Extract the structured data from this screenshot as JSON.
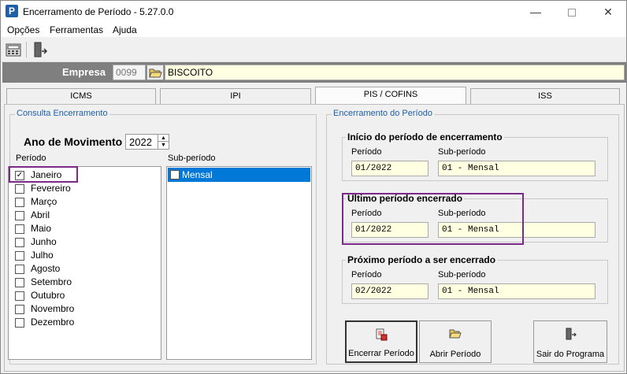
{
  "window": {
    "title": "Encerramento de Período - 5.27.0.0",
    "icon_letter": "P",
    "controls": [
      "minimize-icon",
      "maximize-icon",
      "close-icon"
    ]
  },
  "menu": [
    "Opções",
    "Ferramentas",
    "Ajuda"
  ],
  "toolbar": {
    "icons": [
      "calculator-icon",
      "exit-door-icon"
    ]
  },
  "empresa": {
    "label": "Empresa",
    "code_value": "0099",
    "name_value": "BISCOITO"
  },
  "tabs": [
    {
      "label": "ICMS",
      "active": false
    },
    {
      "label": "IPI",
      "active": false
    },
    {
      "label": "PIS / COFINS",
      "active": true
    },
    {
      "label": "ISS",
      "active": false
    }
  ],
  "consulta": {
    "title": "Consulta Encerramento",
    "ano_label": "Ano de Movimento",
    "ano_value": "2022",
    "periodo_label": "Período",
    "subperiodo_label": "Sub-período",
    "periodos": [
      {
        "label": "Janeiro",
        "checked": true
      },
      {
        "label": "Fevereiro",
        "checked": false
      },
      {
        "label": "Março",
        "checked": false
      },
      {
        "label": "Abril",
        "checked": false
      },
      {
        "label": "Maio",
        "checked": false
      },
      {
        "label": "Junho",
        "checked": false
      },
      {
        "label": "Julho",
        "checked": false
      },
      {
        "label": "Agosto",
        "checked": false
      },
      {
        "label": "Setembro",
        "checked": false
      },
      {
        "label": "Outubro",
        "checked": false
      },
      {
        "label": "Novembro",
        "checked": false
      },
      {
        "label": "Dezembro",
        "checked": false
      }
    ],
    "subperiodos": [
      {
        "label": "Mensal",
        "checked": false,
        "selected": true
      }
    ]
  },
  "encerramento": {
    "title": "Encerramento do Período",
    "inicio": {
      "title": "Início do período de encerramento",
      "periodo_label": "Período",
      "subperiodo_label": "Sub-período",
      "periodo_value": "01/2022",
      "subperiodo_value": "01 - Mensal"
    },
    "ultimo": {
      "title": "Ultimo período encerrado",
      "periodo_label": "Período",
      "subperiodo_label": "Sub-período",
      "periodo_value": "01/2022",
      "subperiodo_value": "01 - Mensal"
    },
    "proximo": {
      "title": "Próximo período a ser encerrado",
      "periodo_label": "Período",
      "subperiodo_label": "Sub-período",
      "periodo_value": "02/2022",
      "subperiodo_value": "01 - Mensal"
    }
  },
  "buttons": {
    "encerrar": "Encerrar Período",
    "abrir": "Abrir Período",
    "sair": "Sair do Programa"
  },
  "colors": {
    "highlight": "#7b2a8a",
    "selection": "#0078d7",
    "readonly_field": "#ffffe1",
    "group_title": "#1f5fa8"
  }
}
